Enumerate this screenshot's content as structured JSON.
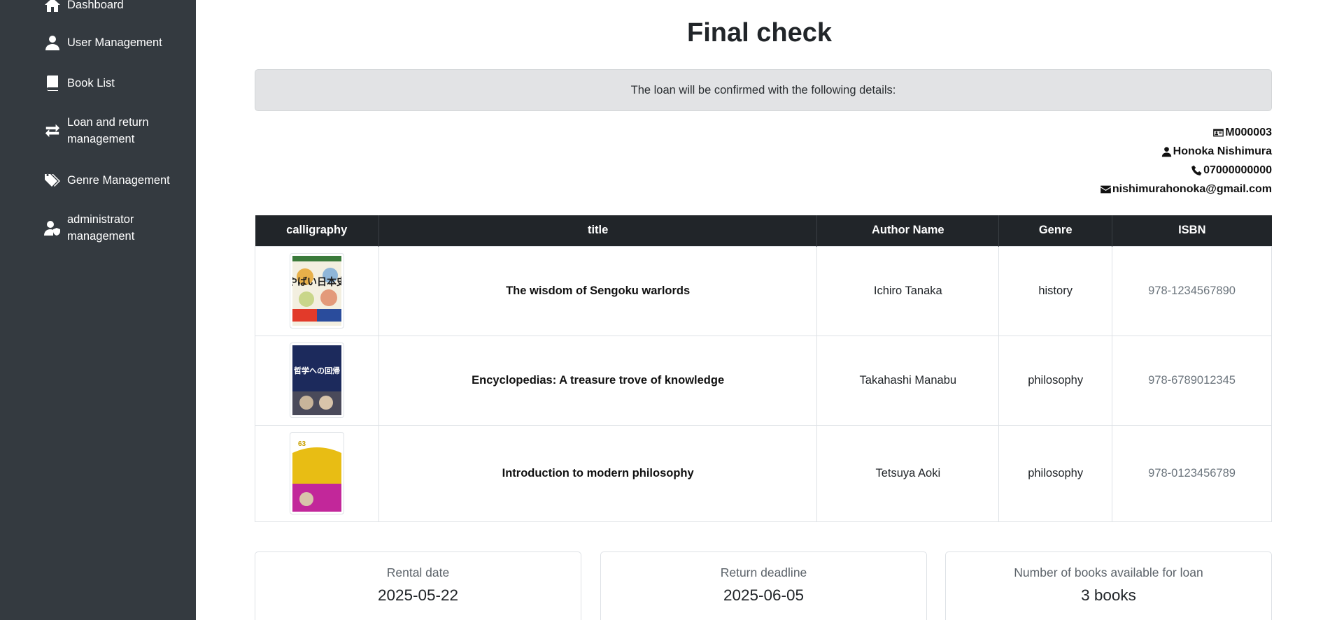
{
  "sidebar": {
    "items": [
      {
        "label": "Dashboard",
        "icon": "home-icon"
      },
      {
        "label": "User Management",
        "icon": "user-icon"
      },
      {
        "label": "Book List",
        "icon": "book-icon"
      },
      {
        "label_line1": "Loan and return",
        "label_line2": "management",
        "icon": "exchange-arrows-icon"
      },
      {
        "label": "Genre Management",
        "icon": "tags-icon"
      },
      {
        "label_line1": "administrator",
        "label_line2": "management",
        "icon": "user-shield-icon"
      }
    ]
  },
  "page": {
    "title": "Final check",
    "alert_text": "The loan will be confirmed with the following details:"
  },
  "member": {
    "id": "M000003",
    "name": "Honoka Nishimura",
    "phone": "07000000000",
    "email": "nishimurahonoka@gmail.com"
  },
  "table": {
    "headers": {
      "cover": "calligraphy",
      "title": "title",
      "author": "Author Name",
      "genre": "Genre",
      "isbn": "ISBN"
    },
    "rows": [
      {
        "title": "The wisdom of Sengoku warlords",
        "author": "Ichiro Tanaka",
        "genre": "history",
        "isbn": "978-1234567890",
        "cover_text": "やばい日本史"
      },
      {
        "title": "Encyclopedias: A treasure trove of knowledge",
        "author": "Takahashi Manabu",
        "genre": "philosophy",
        "isbn": "978-6789012345",
        "cover_text": "哲学への回帰"
      },
      {
        "title": "Introduction to modern philosophy",
        "author": "Tetsuya Aoki",
        "genre": "philosophy",
        "isbn": "978-0123456789",
        "cover_text": "63"
      }
    ]
  },
  "summary": {
    "rental_label": "Rental date",
    "rental_value": "2025-05-22",
    "deadline_label": "Return deadline",
    "deadline_value": "2025-06-05",
    "count_label": "Number of books available for loan",
    "count_value": "3 books"
  },
  "colors": {
    "sidebar_bg": "#343a40",
    "table_header_bg": "#212529",
    "alert_bg": "#e2e3e5"
  }
}
